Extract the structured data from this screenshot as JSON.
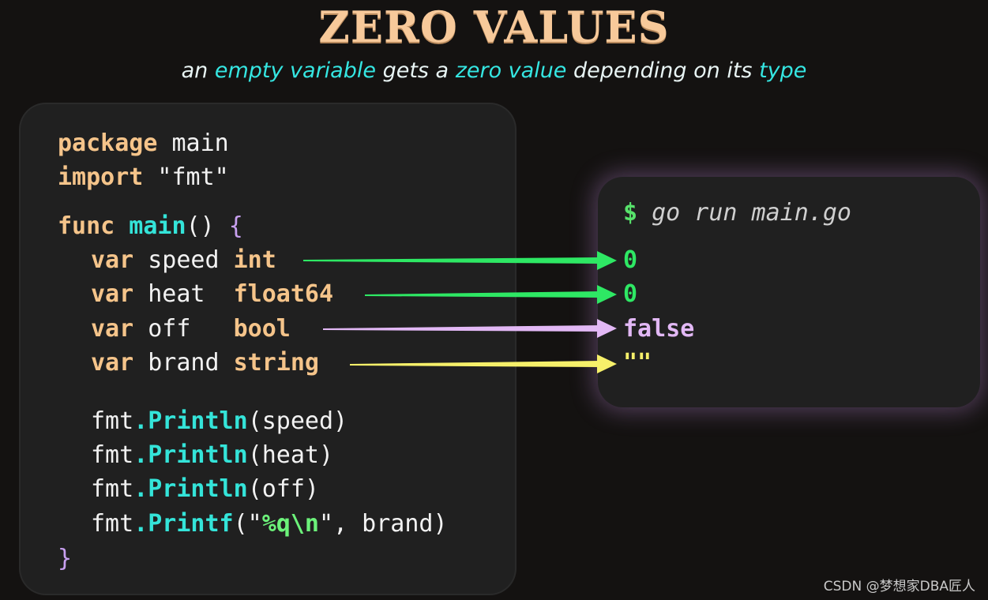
{
  "header": {
    "title": "ZERO VALUES",
    "subtitle_parts": [
      "an ",
      "empty variable",
      " gets a ",
      "zero value",
      " depending on its ",
      "type"
    ]
  },
  "code": {
    "package_kw": "package",
    "package_name": " main",
    "import_kw": "import",
    "import_path": " \"fmt\"",
    "func_kw": "func",
    "func_name": " main",
    "func_sig": "() ",
    "open_brace": "{",
    "close_brace": "}",
    "var_kw": "var",
    "decls": [
      {
        "name": " speed ",
        "type": "int"
      },
      {
        "name": " heat  ",
        "type": "float64"
      },
      {
        "name": " off   ",
        "type": "bool"
      },
      {
        "name": " brand ",
        "type": "string"
      }
    ],
    "fmt_prefix": "fmt",
    "calls": [
      {
        "dot": ".",
        "fn": "Println",
        "args": "(speed)"
      },
      {
        "dot": ".",
        "fn": "Println",
        "args": "(heat)"
      },
      {
        "dot": ".",
        "fn": "Println",
        "args": "(off)"
      },
      {
        "dot": ".",
        "fn": "Printf",
        "args_pre": "(\"",
        "args_esc": "%q\\n",
        "args_post": "\", brand)"
      }
    ]
  },
  "terminal": {
    "prompt": "$",
    "command": " go run main.go",
    "outputs": [
      {
        "text": "0",
        "color": "#2ee864"
      },
      {
        "text": "0",
        "color": "#2ee864"
      },
      {
        "text": "false",
        "color": "#e2b8f5"
      },
      {
        "text": "\"\"",
        "color": "#f6f06a"
      }
    ]
  },
  "arrow_colors": [
    "#2ee864",
    "#2ee864",
    "#e2b8f5",
    "#f6f06a"
  ],
  "watermark": "CSDN @梦想家DBA匠人"
}
